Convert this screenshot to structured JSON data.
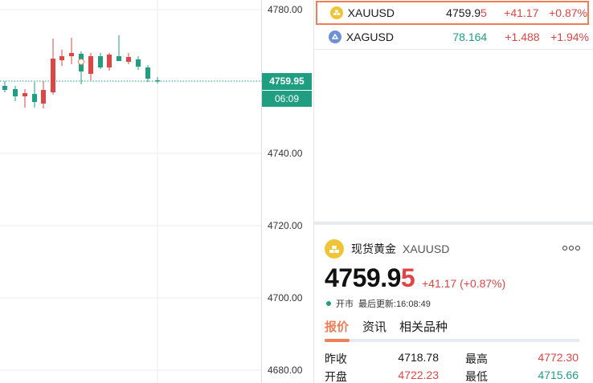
{
  "chart": {
    "y_ticks": [
      "4780.00",
      "4740.00",
      "4720.00",
      "4700.00",
      "4680.00"
    ],
    "current_price_label": "4759.95",
    "countdown_label": "06:09",
    "colors": {
      "up": "#e04545",
      "down": "#1f9e82",
      "grid": "#ececec"
    }
  },
  "watchlist": [
    {
      "symbol": "XAUUSD",
      "price_main": "4759.9",
      "price_last": "5",
      "change": "+41.17",
      "percent": "+0.87%",
      "icon": "gold-bar-icon",
      "selected": true
    },
    {
      "symbol": "XAGUSD",
      "price_main": "78.164",
      "price_last": "",
      "change": "+1.488",
      "percent": "+1.94%",
      "icon": "silver-bar-icon",
      "selected": false
    }
  ],
  "detail": {
    "name": "现货黄金",
    "symbol": "XAUUSD",
    "price_main": "4759.9",
    "price_last": "5",
    "change": "+41.17 (+0.87%)",
    "market_status": "开市",
    "last_update": "最后更新:16:08:49",
    "tabs": [
      "报价",
      "资讯",
      "相关品种"
    ],
    "stats": [
      {
        "label": "昨收",
        "value": "4718.78"
      },
      {
        "label": "最高",
        "value": "4772.30"
      },
      {
        "label": "开盘",
        "value": "4722.23"
      },
      {
        "label": "最低",
        "value": "4715.66"
      }
    ]
  }
}
